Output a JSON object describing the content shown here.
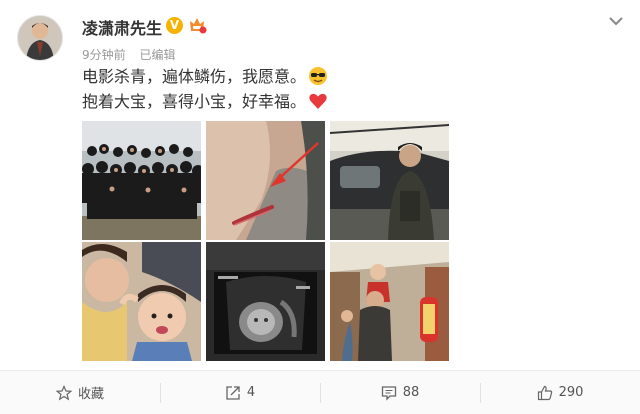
{
  "post": {
    "author": "凌潇肃先生",
    "time": "9分钟前",
    "edited": "已编辑",
    "line1": "电影杀青，遍体鳞伤，我愿意。",
    "line2": "抱着大宝，喜得小宝，好幸福。"
  },
  "icons": {
    "verified": "verified-v-icon",
    "badge": "member-badge-icon",
    "menu": "chevron-down-icon",
    "emoji1": "sunglasses-emoji",
    "emoji2": "red-heart-emoji"
  },
  "images": [
    "group-photo",
    "arm-scar-with-arrow",
    "man-with-helicopter",
    "mother-and-child-selfie",
    "ultrasound-photo",
    "father-carrying-child-street"
  ],
  "actions": {
    "favorite": "收藏",
    "repost_count": "4",
    "comment_count": "88",
    "like_count": "290"
  },
  "colors": {
    "accent": "#f7b200",
    "heart": "#e8393e",
    "arrow": "#e0362c"
  }
}
